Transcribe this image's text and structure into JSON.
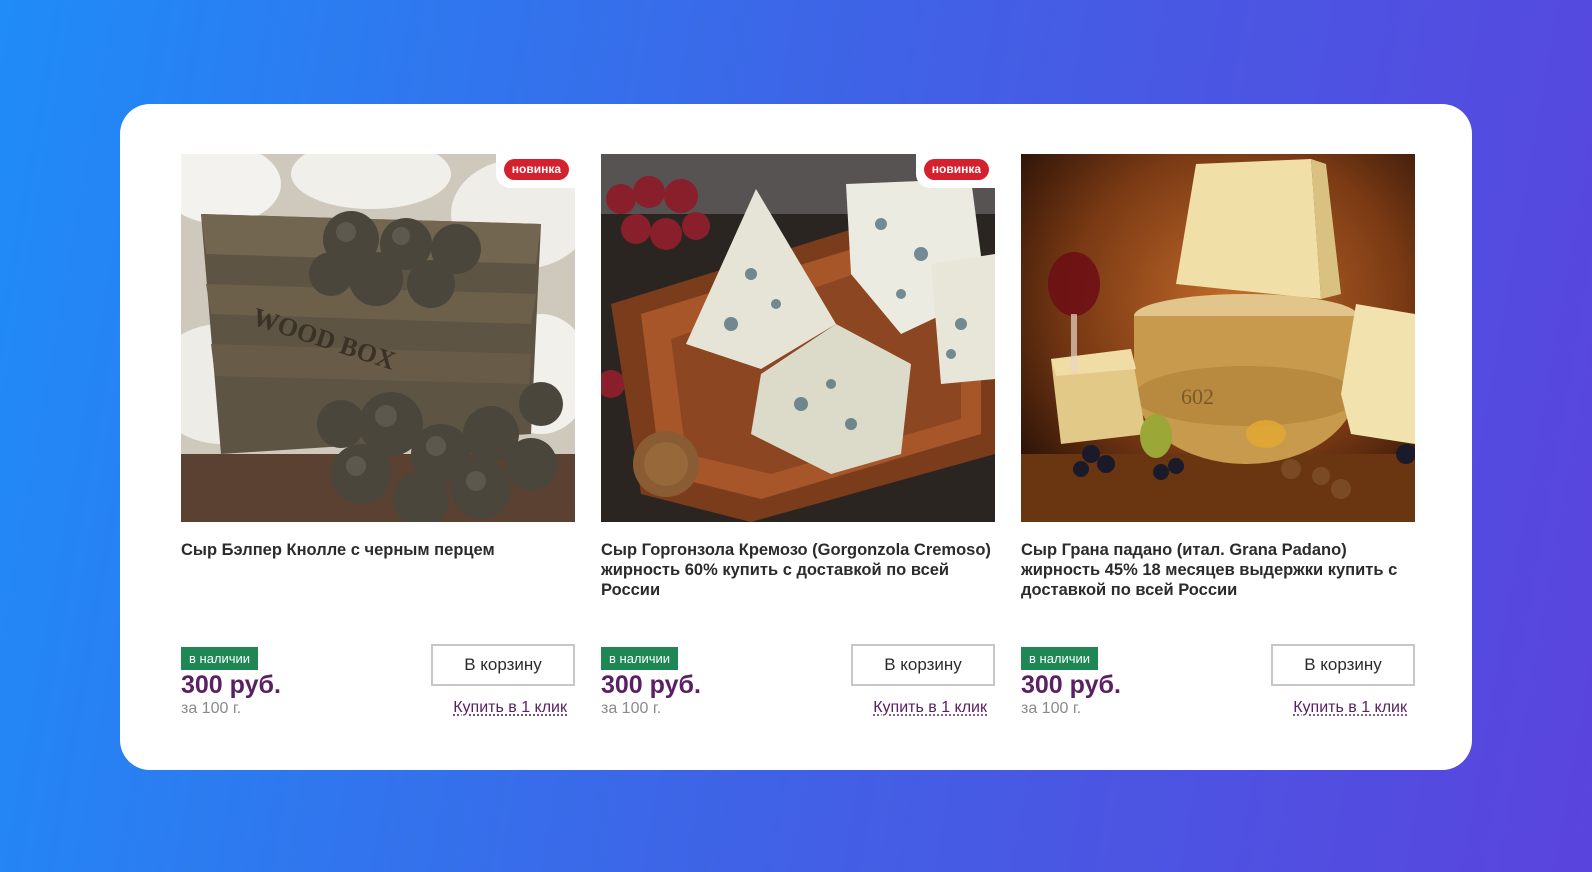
{
  "products": [
    {
      "badge": "новинка",
      "title": "Сыр Бэлпер Кнолле с черным перцем",
      "stock": "в наличии",
      "price": "300 руб.",
      "unit": "за 100 г.",
      "cart_label": "В корзину",
      "one_click_label": "Купить в 1 клик",
      "image": "cheese-balls-in-wooden-box"
    },
    {
      "badge": "новинка",
      "title": "Сыр Горгонзола Кремозо (Gorgonzola Cremoso) жирность 60% купить с доставкой по всей России",
      "stock": "в наличии",
      "price": "300 руб.",
      "unit": "за 100 г.",
      "cart_label": "В корзину",
      "one_click_label": "Купить в 1 клик",
      "image": "blue-cheese-on-tray"
    },
    {
      "title": "Сыр Грана падано (итал. Grana Padano) жирность 45% 18 месяцев выдержки купить с доставкой по всей России",
      "stock": "в наличии",
      "price": "300 руб.",
      "unit": "за 100 г.",
      "cart_label": "В корзину",
      "one_click_label": "Купить в 1 клик",
      "image": "grana-padano-wheel-with-wine"
    }
  ],
  "colors": {
    "badge": "#d5202e",
    "stock": "#1e8753",
    "price": "#5b2063",
    "background_start": "#1f8cf7",
    "background_end": "#5a44de"
  }
}
